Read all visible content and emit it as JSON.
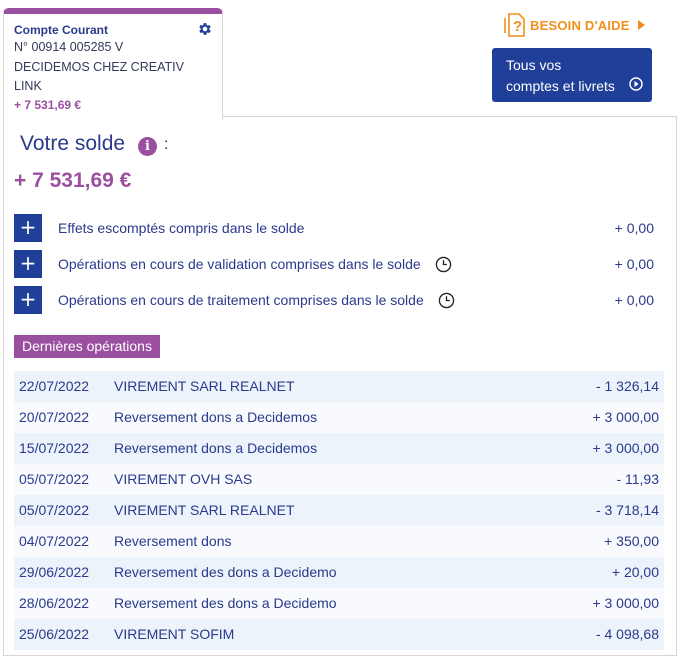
{
  "account": {
    "name": "Compte Courant",
    "number": "N° 00914 005285 V",
    "holder_line1": "DECIDEMOS CHEZ CREATIV",
    "holder_line2": "LINK",
    "balance": "+ 7 531,69 €"
  },
  "help": {
    "label": "BESOIN D'AIDE"
  },
  "all_accounts": {
    "line1": "Tous vos",
    "line2": "comptes et livrets"
  },
  "solde": {
    "title": "Votre solde",
    "colon": ":",
    "amount": "+ 7 531,69 €"
  },
  "details": [
    {
      "label": "Effets escomptés compris dans le solde",
      "value": "+ 0,00",
      "has_clock": false
    },
    {
      "label": "Opérations en cours de validation comprises dans le solde",
      "value": "+ 0,00",
      "has_clock": true
    },
    {
      "label": "Opérations en cours de traitement comprises dans le solde",
      "value": "+ 0,00",
      "has_clock": true
    }
  ],
  "operations_header": "Dernières opérations",
  "operations": [
    {
      "date": "22/07/2022",
      "label": "VIREMENT SARL REALNET",
      "amount": "- 1 326,14"
    },
    {
      "date": "20/07/2022",
      "label": "Reversement dons a Decidemos",
      "amount": "+ 3 000,00"
    },
    {
      "date": "15/07/2022",
      "label": "Reversement dons a Decidemos",
      "amount": "+ 3 000,00"
    },
    {
      "date": "05/07/2022",
      "label": "VIREMENT OVH SAS",
      "amount": "- 11,93"
    },
    {
      "date": "05/07/2022",
      "label": "VIREMENT SARL REALNET",
      "amount": "- 3 718,14"
    },
    {
      "date": "04/07/2022",
      "label": "Reversement dons",
      "amount": "+ 350,00"
    },
    {
      "date": "29/06/2022",
      "label": "Reversement des dons a Decidemo",
      "amount": "+ 20,00"
    },
    {
      "date": "28/06/2022",
      "label": "Reversement des dons a Decidemo",
      "amount": "+ 3 000,00"
    },
    {
      "date": "25/06/2022",
      "label": "VIREMENT SOFIM",
      "amount": "- 4 098,68"
    }
  ],
  "colors": {
    "brand_purple": "#9b4fa0",
    "brand_blue": "#1f3f99",
    "help_orange": "#f0901a"
  },
  "icons": {
    "settings": "gear-icon",
    "help": "question-doc-icon",
    "info": "info-icon",
    "pending": "clock-icon",
    "expand": "plus-icon",
    "go": "arrow-circle-icon"
  }
}
